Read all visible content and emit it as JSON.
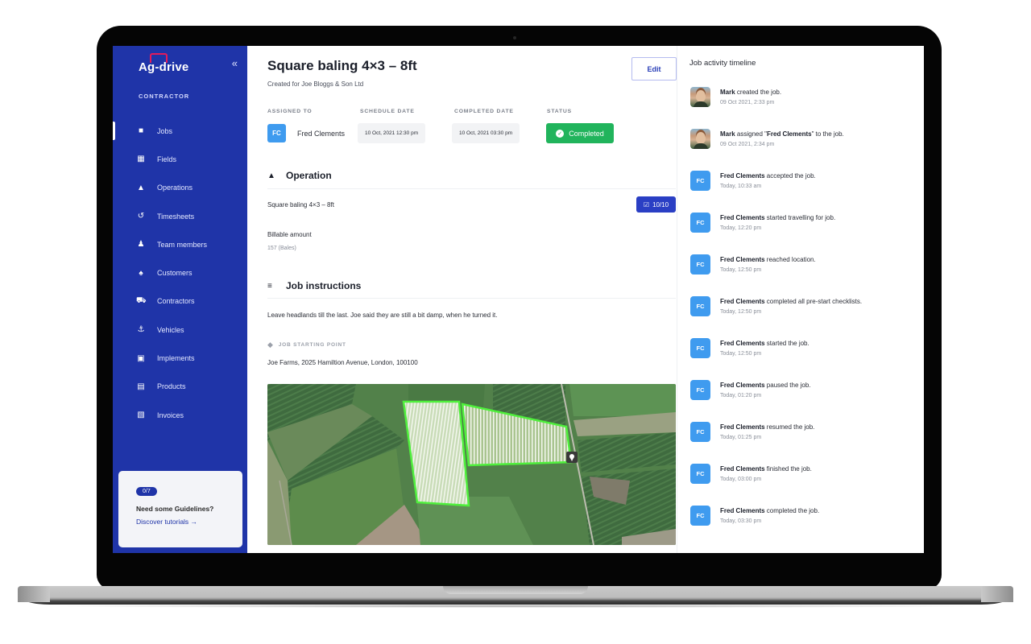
{
  "sidebar": {
    "brand": "Ag-drive",
    "collapse_icon": "double-chevron-left",
    "role": "CONTRACTOR",
    "items": [
      {
        "label": "Jobs",
        "icon": "briefcase",
        "active": true
      },
      {
        "label": "Fields",
        "icon": "grid-fields"
      },
      {
        "label": "Operations",
        "icon": "shapes"
      },
      {
        "label": "Timesheets",
        "icon": "history-clock"
      },
      {
        "label": "Team members",
        "icon": "people"
      },
      {
        "label": "Customers",
        "icon": "person-card"
      },
      {
        "label": "Contractors",
        "icon": "truck"
      },
      {
        "label": "Vehicles",
        "icon": "tractor"
      },
      {
        "label": "Implements",
        "icon": "trailer"
      },
      {
        "label": "Products",
        "icon": "archive-box"
      },
      {
        "label": "Invoices",
        "icon": "receipt"
      }
    ],
    "guide": {
      "progress": "0/7",
      "question": "Need some Guidelines?",
      "link": "Discover tutorials →"
    }
  },
  "job": {
    "title": "Square baling 4×3 – 8ft",
    "subtitle": "Created for Joe Bloggs & Son Ltd",
    "edit_label": "Edit",
    "meta": {
      "assigned_to_label": "ASSIGNED TO",
      "schedule_date_label": "SCHEDULE DATE",
      "completed_date_label": "COMPLETED DATE",
      "status_label": "STATUS",
      "assignee_initials": "FC",
      "assignee_name": "Fred Clements",
      "schedule_date": "10 Oct, 2021 12:30 pm",
      "completed_date": "10 Oct, 2021 03:30 pm",
      "status": "Completed",
      "status_color": "#21b45c"
    },
    "operation": {
      "heading": "Operation",
      "name": "Square baling 4×3 – 8ft",
      "checklist": "10/10",
      "billable_label": "Billable amount",
      "billable_value": "157 (Bales)"
    },
    "instructions": {
      "heading": "Job instructions",
      "text": "Leave headlands till the last. Joe said they are still a bit damp, when he turned it.",
      "starting_point_label": "JOB STARTING POINT",
      "starting_point": "Joe Farms, 2025 Hamiltion Avenue, London, 100100"
    }
  },
  "timeline": {
    "title": "Job activity timeline",
    "items": [
      {
        "avatar": "photo",
        "actor": "Mark",
        "action": " created the job.",
        "time": "09 Oct 2021, 2:33 pm"
      },
      {
        "avatar": "photo",
        "actor": "Mark",
        "action_pre": " assigned \"",
        "target": "Fred Clements",
        "action_post": "\" to the job.",
        "time": "09 Oct 2021, 2:34 pm"
      },
      {
        "avatar": "FC",
        "actor": "Fred Clements",
        "action": " accepted the job.",
        "time": "Today, 10:33 am"
      },
      {
        "avatar": "FC",
        "actor": "Fred Clements",
        "action": " started travelling for job.",
        "time": "Today, 12:20 pm"
      },
      {
        "avatar": "FC",
        "actor": "Fred Clements",
        "action": " reached location.",
        "time": "Today, 12:50 pm"
      },
      {
        "avatar": "FC",
        "actor": "Fred Clements",
        "action": " completed all pre-start checklists.",
        "time": "Today, 12:50 pm"
      },
      {
        "avatar": "FC",
        "actor": "Fred Clements",
        "action": " started the job.",
        "time": "Today, 12:50 pm"
      },
      {
        "avatar": "FC",
        "actor": "Fred Clements",
        "action": " paused the job.",
        "time": "Today, 01:20 pm"
      },
      {
        "avatar": "FC",
        "actor": "Fred Clements",
        "action": " resumed the job.",
        "time": "Today, 01:25 pm"
      },
      {
        "avatar": "FC",
        "actor": "Fred Clements",
        "action": " finished the job.",
        "time": "Today, 03:00 pm"
      },
      {
        "avatar": "FC",
        "actor": "Fred Clements",
        "action": " completed the job.",
        "time": "Today, 03:30 pm"
      }
    ]
  }
}
